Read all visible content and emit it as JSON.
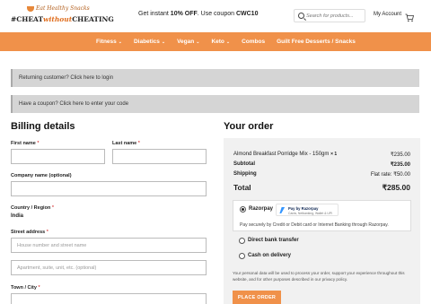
{
  "header": {
    "logo_top": "Eat Healthy Snacks",
    "logo_main_pre": "#CHEAT",
    "logo_main_hl": "without",
    "logo_main_post": "CHEATING",
    "promo_pre": "Get instant ",
    "promo_bold": "10% OFF",
    "promo_mid": ". Use coupon ",
    "promo_code": "CWC10",
    "search_placeholder": "Search for products...",
    "account_label": "My Account",
    "icons": {
      "search": "search-icon",
      "cart": "cart-icon"
    }
  },
  "nav": {
    "items": [
      {
        "label": "Fitness",
        "has_dropdown": true
      },
      {
        "label": "Diabetics",
        "has_dropdown": true
      },
      {
        "label": "Vegan",
        "has_dropdown": true
      },
      {
        "label": "Keto",
        "has_dropdown": true
      },
      {
        "label": "Combos",
        "has_dropdown": false
      },
      {
        "label": "Guilt Free Desserts / Snacks",
        "has_dropdown": false
      }
    ],
    "chevron": "⌄"
  },
  "notices": {
    "returning": "Returning customer? Click here to login",
    "coupon": "Have a coupon? Click here to enter your code"
  },
  "billing": {
    "title": "Billing details",
    "first_name_label": "First name",
    "last_name_label": "Last name",
    "company_label": "Company name (optional)",
    "country_label": "Country / Region",
    "country_value": "India",
    "street_label": "Street address",
    "street_placeholder_1": "House number and street name",
    "street_placeholder_2": "Apartment, suite, unit, etc. (optional)",
    "city_label": "Town / City",
    "required_mark": "*"
  },
  "order": {
    "title": "Your order",
    "item_name": "Almond Breakfast Porridge Mix - 150gm",
    "item_qty": "× 1",
    "item_price": "₹235.00",
    "subtotal_label": "Subtotal",
    "subtotal_value": "₹235.00",
    "shipping_label": "Shipping",
    "shipping_value": "Flat rate: ₹50.00",
    "total_label": "Total",
    "total_value": "₹285.00",
    "payment": {
      "razorpay_label": "Razorpay",
      "badge_title": "Pay by Razorpay",
      "badge_sub": "Cards, Netbanking, Wallet & UPI",
      "razorpay_desc": "Pay securely by Credit or Debit card or Internet Banking through Razorpay.",
      "bank_transfer_label": "Direct bank transfer",
      "cod_label": "Cash on delivery"
    },
    "privacy_text": "Your personal data will be used to process your order, support your experience throughout this website, and for other purposes described in our privacy policy.",
    "place_order_label": "PLACE ORDER"
  },
  "colors": {
    "accent": "#f0914a",
    "notice_bg": "#d5d5d5",
    "order_bg": "#f1f1f1",
    "required": "#cc0000"
  }
}
